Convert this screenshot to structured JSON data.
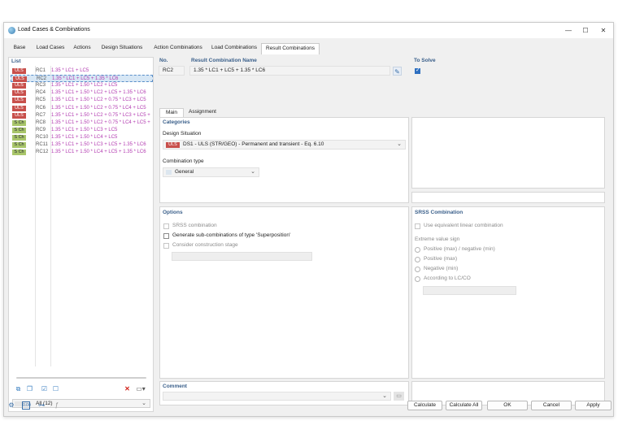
{
  "window": {
    "title": "Load Cases & Combinations",
    "controls": {
      "minimize": "—",
      "maximize": "☐",
      "close": "✕"
    }
  },
  "tabs": [
    "Base",
    "Load Cases",
    "Actions",
    "Design Situations",
    "Action Combinations",
    "Load Combinations",
    "Result Combinations"
  ],
  "list": {
    "label": "List",
    "rows": [
      {
        "badge": "ULS",
        "id": "RC1",
        "expr": "1.35 * LC1 + LC5"
      },
      {
        "badge": "ULS",
        "id": "RC2",
        "expr": "1.35 * LC1 + LC5 + 1.35 * LC6"
      },
      {
        "badge": "ULS",
        "id": "RC3",
        "expr": "1.35 * LC1 + 1.50 * LC2 + LC5"
      },
      {
        "badge": "ULS",
        "id": "RC4",
        "expr": "1.35 * LC1 + 1.50 * LC2 + LC5 + 1.35 * LC6"
      },
      {
        "badge": "ULS",
        "id": "RC5",
        "expr": "1.35 * LC1 + 1.50 * LC2 + 0.75 * LC3 + LC5"
      },
      {
        "badge": "ULS",
        "id": "RC6",
        "expr": "1.35 * LC1 + 1.50 * LC2 + 0.75 * LC4 + LC5"
      },
      {
        "badge": "ULS",
        "id": "RC7",
        "expr": "1.35 * LC1 + 1.50 * LC2 + 0.75 * LC3 + LC5 +"
      },
      {
        "badge": "S Ch",
        "id": "RC8",
        "expr": "1.35 * LC1 + 1.50 * LC2 + 0.75 * LC4 + LC5 +"
      },
      {
        "badge": "S Ch",
        "id": "RC9",
        "expr": "1.35 * LC1 + 1.50 * LC3 + LC5"
      },
      {
        "badge": "S Ch",
        "id": "RC10",
        "expr": "1.35 * LC1 + 1.50 * LC4 + LC5"
      },
      {
        "badge": "S Ch",
        "id": "RC11",
        "expr": "1.35 * LC1 + 1.50 * LC3 + LC5 + 1.35 * LC6"
      },
      {
        "badge": "S Ch",
        "id": "RC12",
        "expr": "1.35 * LC1 + 1.50 * LC4 + LC5 + 1.35 * LC6"
      }
    ],
    "filter": "All (12)"
  },
  "header": {
    "no_label": "No.",
    "no_value": "RC2",
    "name_label": "Result Combination Name",
    "name_value": "1.35 * LC1 + LC5 + 1.35 * LC6",
    "to_solve_label": "To Solve"
  },
  "subtabs": [
    "Main",
    "Assignment"
  ],
  "categories": {
    "label": "Categories",
    "design_situation_label": "Design Situation",
    "design_situation_badge": "ULS",
    "design_situation_value": "DS1 - ULS (STR/GEO) - Permanent and transient - Eq. 6.10",
    "combination_type_label": "Combination type",
    "combination_type_value": "General"
  },
  "options": {
    "label": "Options",
    "srss": "SRSS combination",
    "superposition": "Generate sub-combinations of type 'Superposition'",
    "construction_stage": "Consider construction stage"
  },
  "srss_combination": {
    "label": "SRSS Combination",
    "equivalent_linear": "Use equivalent linear combination",
    "extreme_value_sign": "Extreme value sign",
    "radios": [
      "Positive (max) / negative (min)",
      "Positive (max)",
      "Negative (min)",
      "According to LC/CO"
    ]
  },
  "comment": {
    "label": "Comment"
  },
  "buttons": {
    "calculate": "Calculate",
    "calculate_all": "Calculate All",
    "ok": "OK",
    "cancel": "Cancel",
    "apply": "Apply"
  },
  "colors": {
    "uls_badge": "#c8504c",
    "sch_badge": "#a9c66a",
    "expression": "#b23ab0",
    "accent": "#2d6fc0"
  }
}
